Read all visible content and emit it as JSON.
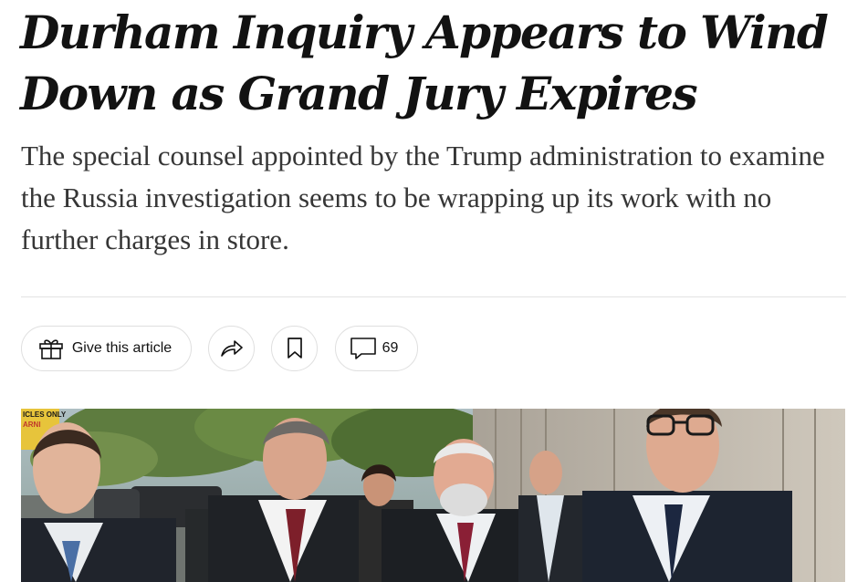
{
  "article": {
    "headline": "Durham Inquiry Appears to Wind Down as Grand Jury Expires",
    "summary": "The special counsel appointed by the Trump administration to examine the Russia investigation seems to be wrapping up its work with no further charges in store."
  },
  "toolbar": {
    "gift_label": "Give this article",
    "gift_icon": "gift-icon",
    "share_icon": "share-arrow-icon",
    "save_icon": "bookmark-icon",
    "comments_icon": "comment-bubble-icon",
    "comments_count": "69"
  },
  "photo": {
    "sign_text_1": "ICLES ONLY",
    "sign_text_2": "ARNI"
  }
}
